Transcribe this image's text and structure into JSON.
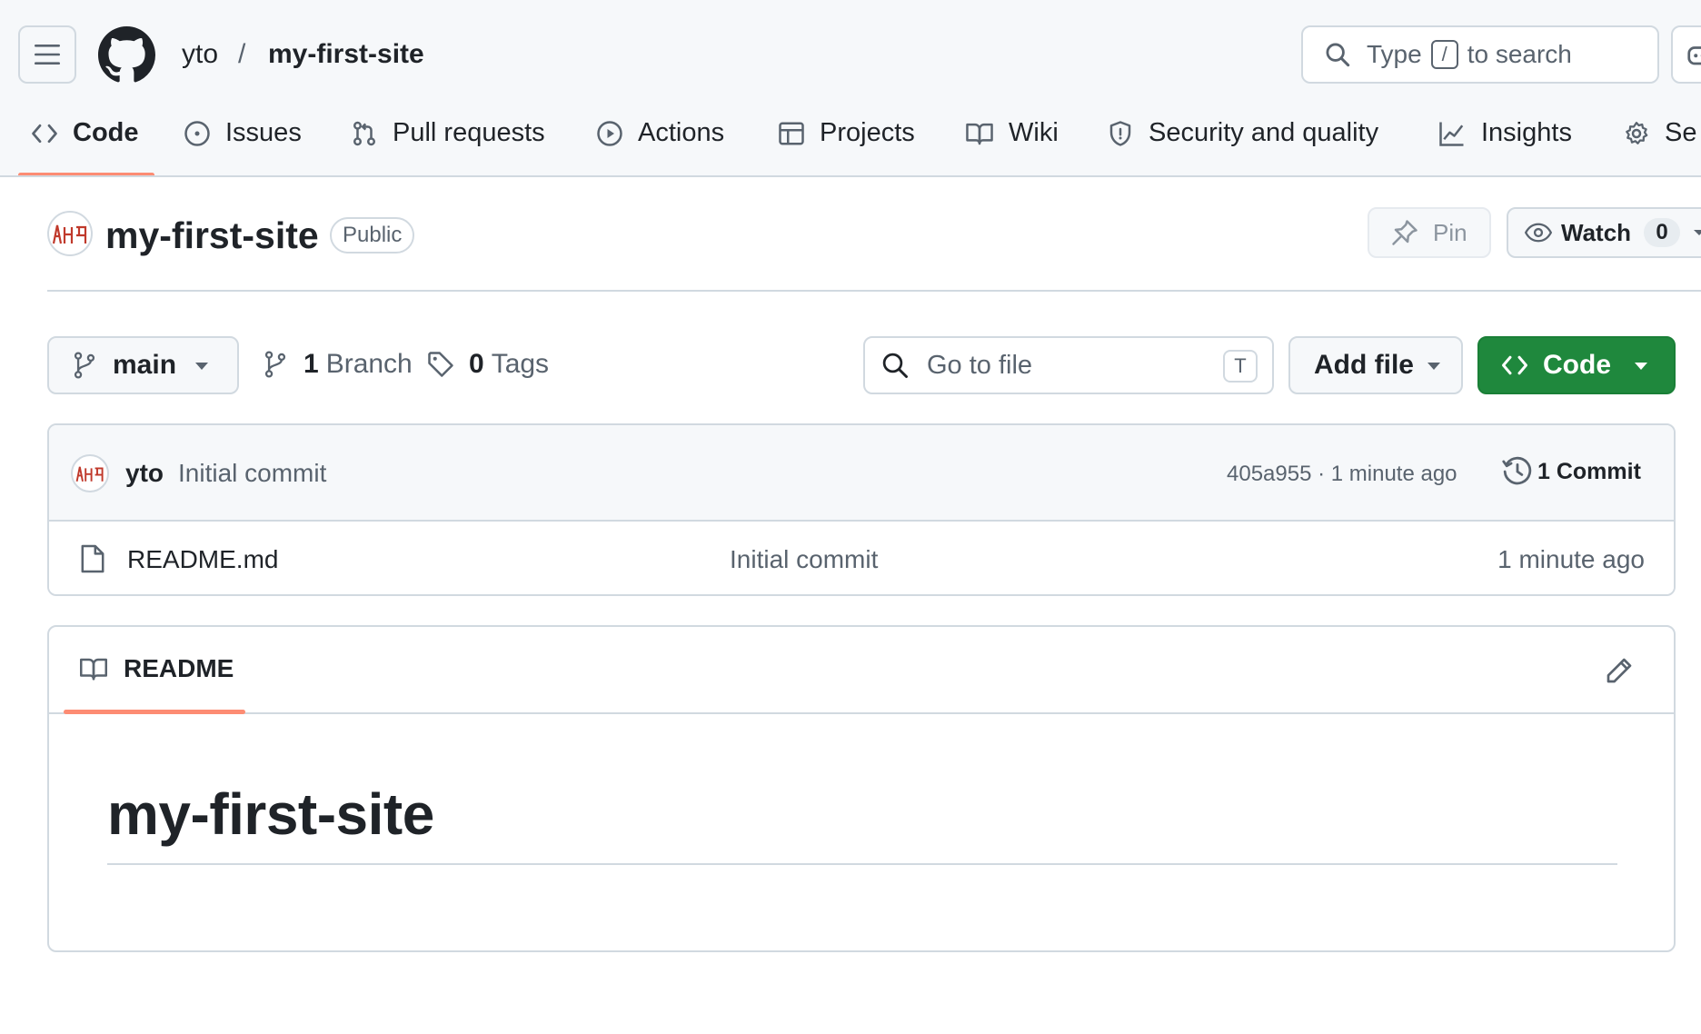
{
  "header": {
    "owner": "yto",
    "separator": "/",
    "repo": "my-first-site",
    "search": {
      "prefix": "Type",
      "key": "/",
      "suffix": "to search"
    }
  },
  "nav": {
    "tabs": [
      {
        "label": "Code",
        "icon": "code-icon",
        "selected": true
      },
      {
        "label": "Issues",
        "icon": "issue-opened-icon"
      },
      {
        "label": "Pull requests",
        "icon": "git-pull-request-icon"
      },
      {
        "label": "Actions",
        "icon": "play-icon"
      },
      {
        "label": "Projects",
        "icon": "table-icon"
      },
      {
        "label": "Wiki",
        "icon": "book-icon"
      },
      {
        "label": "Security and quality",
        "icon": "shield-icon"
      },
      {
        "label": "Insights",
        "icon": "graph-icon"
      },
      {
        "label": "Se",
        "icon": "gear-icon"
      }
    ]
  },
  "repo": {
    "title": "my-first-site",
    "visibility": "Public",
    "pin_label": "Pin",
    "watch_label": "Watch",
    "watch_count": "0"
  },
  "toolbar": {
    "branch": "main",
    "branch_count": "1",
    "branch_label": "Branch",
    "tag_count": "0",
    "tag_label": "Tags",
    "goto_placeholder": "Go to file",
    "goto_key": "T",
    "add_file_label": "Add file",
    "code_label": "Code"
  },
  "commit": {
    "author": "yto",
    "message": "Initial commit",
    "meta": "405a955 · 1 minute ago",
    "history_label": "1 Commit"
  },
  "files": [
    {
      "name": "README.md",
      "message": "Initial commit",
      "age": "1 minute ago",
      "icon": "file-icon"
    }
  ],
  "readme": {
    "tab_label": "README",
    "heading": "my-first-site"
  },
  "colors": {
    "accent_underline": "#fd8c73",
    "primary_button": "#1f883d",
    "avatar_red": "#c0392b"
  }
}
